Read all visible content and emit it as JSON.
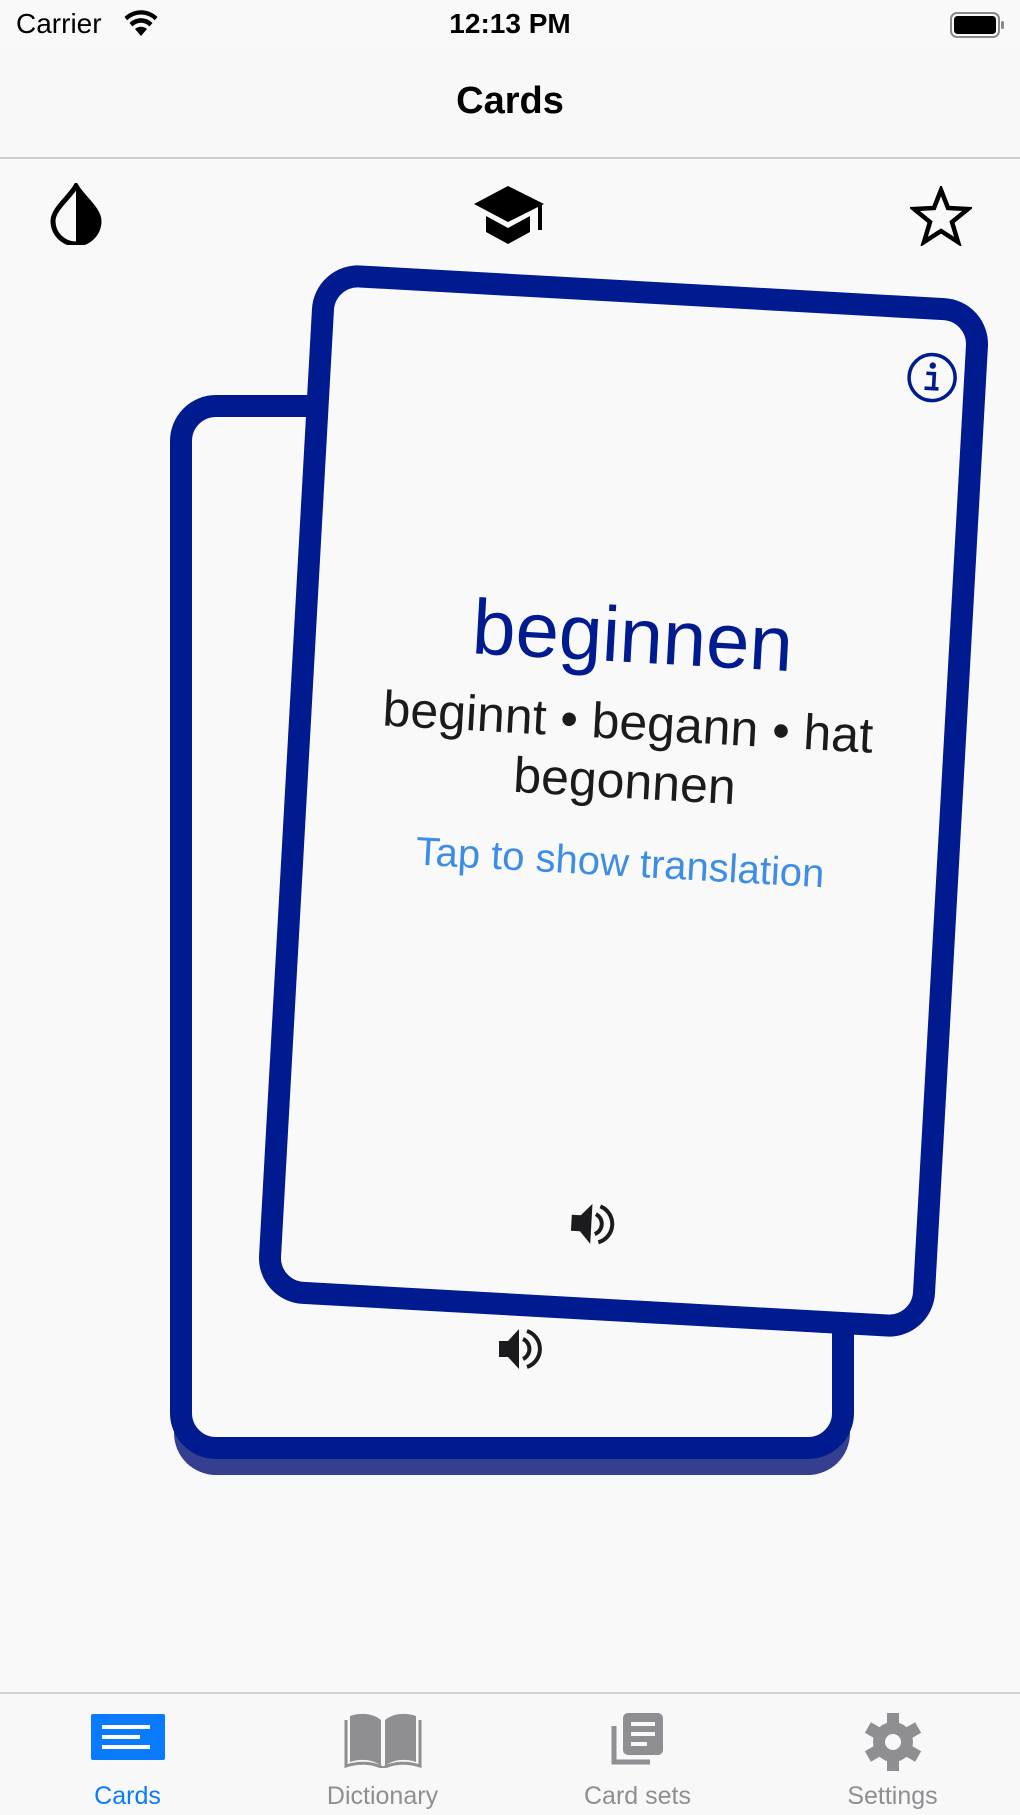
{
  "status_bar": {
    "carrier": "Carrier",
    "time": "12:13 PM",
    "wifi_icon": "wifi-icon",
    "battery_icon": "battery-full-icon"
  },
  "nav": {
    "title": "Cards"
  },
  "toolbar": {
    "left_icon": "contrast-drop-icon",
    "center_icon": "graduation-cap-icon",
    "right_icon": "star-outline-icon"
  },
  "card": {
    "word": "beginnen",
    "forms": "beginnt • begann • hat begonnen",
    "hint": "Tap to show translation",
    "info_icon": "info-icon",
    "speaker_icon": "speaker-icon"
  },
  "colors": {
    "card_border": "#001a8f",
    "accent": "#0a7aff",
    "hint": "#3d8ce6",
    "tab_inactive": "#8e8e93"
  },
  "tabs": [
    {
      "label": "Cards",
      "icon": "cards-icon",
      "active": true
    },
    {
      "label": "Dictionary",
      "icon": "book-icon",
      "active": false
    },
    {
      "label": "Card sets",
      "icon": "card-sets-icon",
      "active": false
    },
    {
      "label": "Settings",
      "icon": "gear-icon",
      "active": false
    }
  ]
}
